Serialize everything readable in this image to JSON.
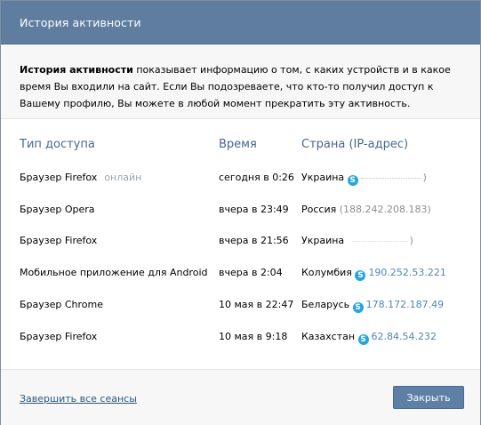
{
  "dialog": {
    "title": "История активности"
  },
  "intro": {
    "bold": "История активности",
    "text": " показывает информацию о том, с каких устройств и в какое время Вы входили на сайт. Если Вы подозреваете, что кто-то получил доступ к Вашему профилю, Вы можете в любой момент прекратить эту активность."
  },
  "table": {
    "headers": [
      "Тип доступа",
      "Время",
      "Страна (IP-адрес)"
    ],
    "rows": [
      {
        "type": "Браузер Firefox",
        "status": "онлайн",
        "time": "сегодня в 0:26",
        "country": "Украина",
        "ip": "",
        "skype": true,
        "ip_color": "masked"
      },
      {
        "type": "Браузер Opera",
        "status": "",
        "time": "вчера в 23:49",
        "country": "Россия",
        "ip": "(188.242.208.183)",
        "skype": false,
        "ip_color": "grey"
      },
      {
        "type": "Браузер Firefox",
        "status": "",
        "time": "вчера в 21:56",
        "country": "Украина",
        "ip": "",
        "skype": false,
        "ip_color": "masked"
      },
      {
        "type": "Мобильное приложение для Android",
        "status": "",
        "time": "вчера в 2:04",
        "country": "Колумбия",
        "ip": "190.252.53.221",
        "skype": true,
        "ip_color": "blue"
      },
      {
        "type": "Браузер Chrome",
        "status": "",
        "time": "10 мая в 22:47",
        "country": "Беларусь",
        "ip": "178.172.187.49",
        "skype": true,
        "ip_color": "blue"
      },
      {
        "type": "Браузер Firefox",
        "status": "",
        "time": "10 мая в 9:18",
        "country": "Казахстан",
        "ip": "62.84.54.232",
        "skype": true,
        "ip_color": "blue"
      }
    ]
  },
  "footer": {
    "end_sessions": "Завершить все сеансы",
    "close": "Закрыть"
  },
  "colors": {
    "titlebar": "#5f7d9e",
    "header_text": "#45688e",
    "link": "#2b587a",
    "ip_blue": "#4f86b8",
    "button": "#5e80a7"
  }
}
